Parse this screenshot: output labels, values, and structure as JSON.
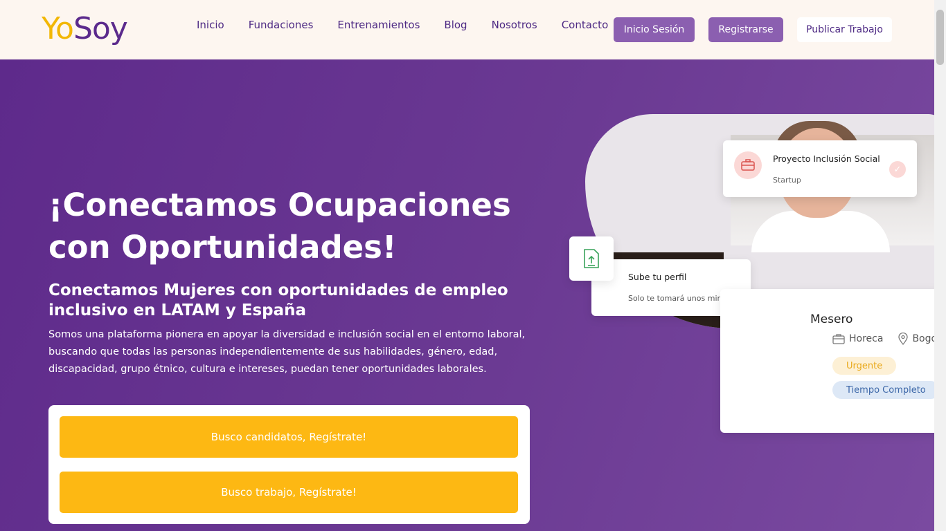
{
  "header": {
    "logo": {
      "part1": "Yo",
      "part2": "S",
      "part3": "oy"
    },
    "nav": [
      "Inicio",
      "Fundaciones",
      "Entrenamientos",
      "Blog",
      "Nosotros",
      "Contacto"
    ],
    "login_label": "Inicio Sesión",
    "register_label": "Registrarse",
    "publish_label": "Publicar Trabajo"
  },
  "hero": {
    "title": "¡Conectamos Ocupaciones con Oportunidades!",
    "subtitle": "Conectamos Mujeres con oportunidades de empleo inclusivo en LATAM y España",
    "description": "Somos una plataforma pionera en apoyar la diversidad e inclusión social en el entorno laboral, buscando que todas las personas independientemente de sus habilidades, género, edad, discapacidad, grupo étnico, cultura e intereses, puedan tener oportunidades laborales.",
    "cta_candidates": "Busco candidatos, Regístrate!",
    "cta_job": "Busco trabajo, Regístrate!"
  },
  "cards": {
    "project": {
      "title": "Proyecto Inclusión Social",
      "subtitle": "Startup",
      "icon": "briefcase-icon",
      "check_icon": "check-icon"
    },
    "upload": {
      "title": "Sube tu perfil",
      "subtitle": "Solo te tomará unos minutos",
      "icon": "upload-file-icon"
    },
    "job": {
      "title": "Mesero",
      "category": "Horeca",
      "location": "Bogo",
      "badge_urgent": "Urgente",
      "badge_type": "Tiempo Completo"
    }
  },
  "colors": {
    "brand_purple": "#5e2a8b",
    "button_purple": "#8b5fb0",
    "accent_yellow": "#fdb813",
    "header_bg": "#fdf6f0"
  }
}
